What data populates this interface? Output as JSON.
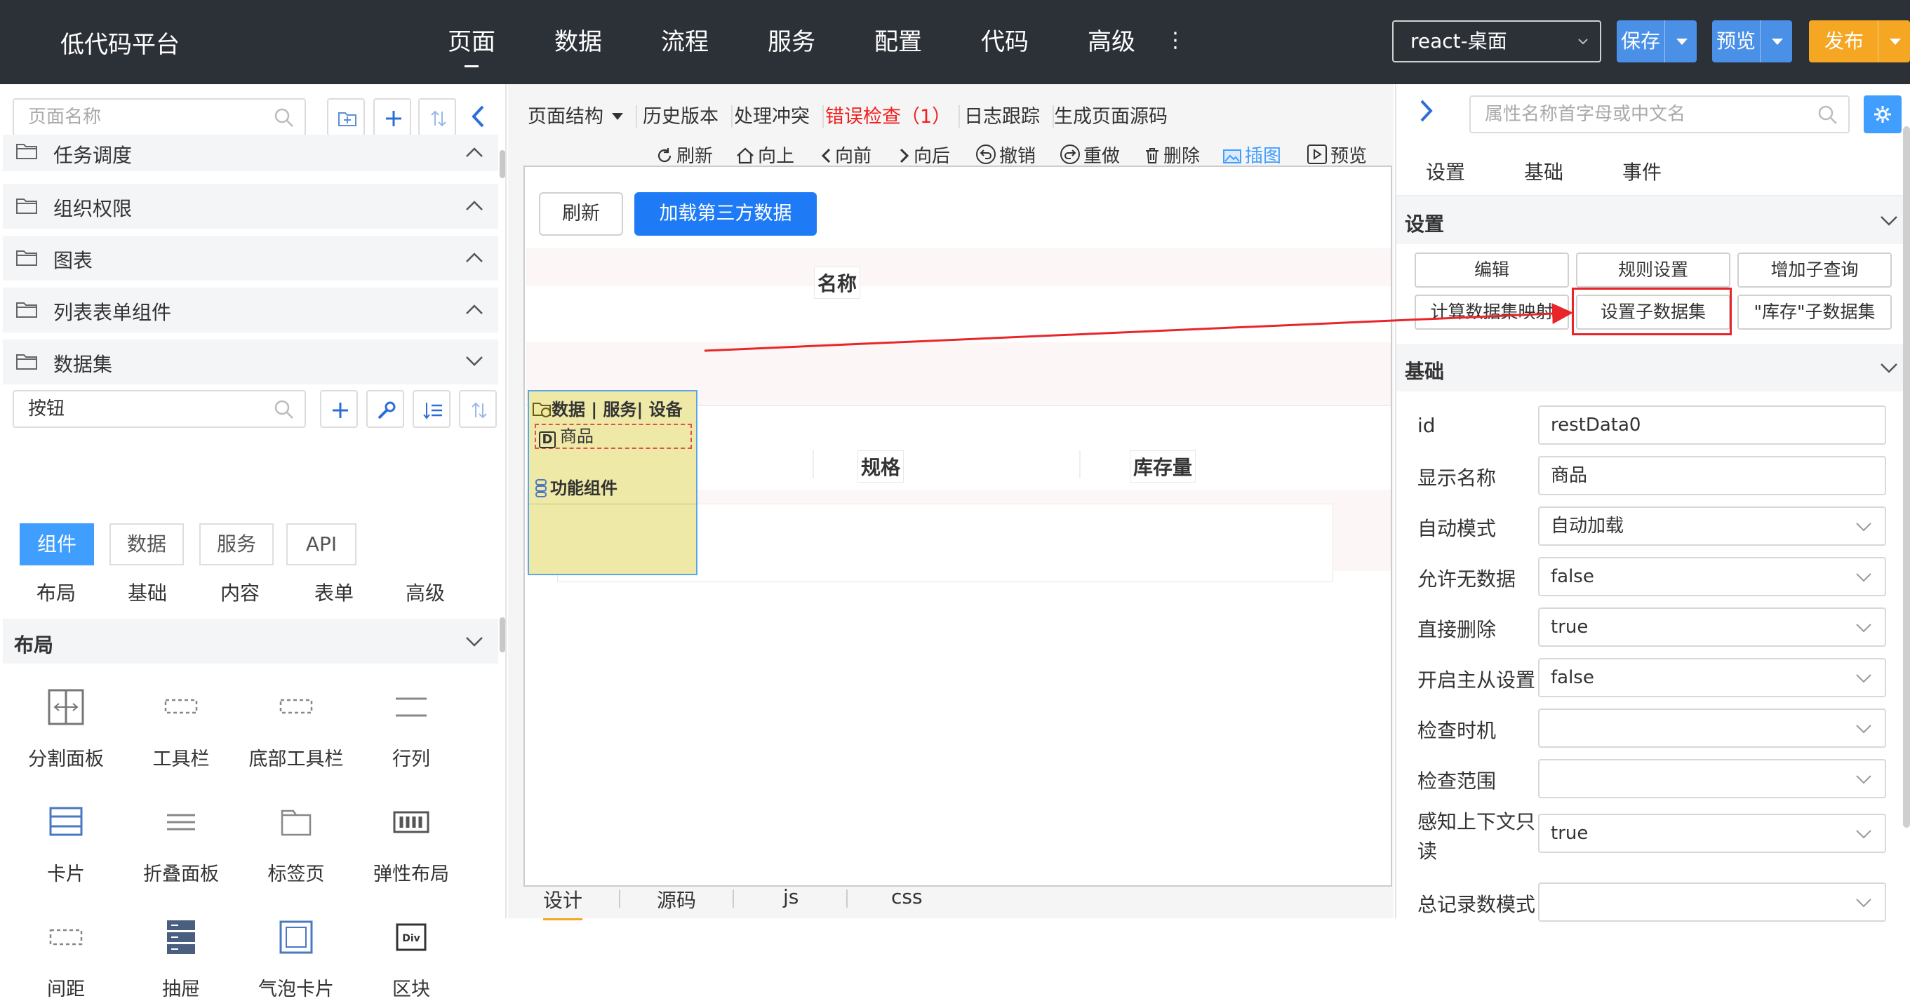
{
  "app": {
    "title": "低代码平台"
  },
  "topnav": {
    "items": [
      "页面",
      "数据",
      "流程",
      "服务",
      "配置",
      "代码",
      "高级"
    ],
    "more": "⋮"
  },
  "top_actions": {
    "env": "react-桌面",
    "save": "保存",
    "preview": "预览",
    "publish": "发布"
  },
  "left": {
    "page_search_placeholder": "页面名称",
    "tree": [
      "任务调度",
      "组织权限",
      "图表",
      "列表表单组件",
      "数据集"
    ],
    "comp_search_value": "按钮",
    "tabs": [
      "组件",
      "数据",
      "服务",
      "API"
    ],
    "subtabs": [
      "布局",
      "基础",
      "内容",
      "表单",
      "高级"
    ],
    "section_title": "布局",
    "components": [
      "分割面板",
      "工具栏",
      "底部工具栏",
      "行列",
      "卡片",
      "折叠面板",
      "标签页",
      "弹性布局",
      "间距",
      "抽屉",
      "气泡卡片",
      "区块"
    ],
    "block_icon_text": "Div"
  },
  "center": {
    "toolbar": [
      "页面结构",
      "历史版本",
      "处理冲突",
      "错误检查（1）",
      "日志跟踪",
      "生成页面源码"
    ],
    "actions": [
      "刷新",
      "向上",
      "向前",
      "向后",
      "撤销",
      "重做",
      "删除",
      "插图",
      "预览"
    ],
    "btn_refresh": "刷新",
    "btn_load": "加载第三方数据",
    "col_name": "名称",
    "col_spec": "规格",
    "col_stock": "库存量",
    "ds_header": "数据 | 服务| 设备",
    "ds_item_mark": "D",
    "ds_item": "商品",
    "ds_func": "功能组件",
    "bottom_tabs": [
      "设计",
      "源码",
      "js",
      "css"
    ]
  },
  "right": {
    "search_placeholder": "属性名称首字母或中文名",
    "tabs": [
      "设置",
      "基础",
      "事件"
    ],
    "settings_title": "设置",
    "settings_buttons": [
      "编辑",
      "规则设置",
      "增加子查询",
      "计算数据集映射",
      "设置子数据集",
      "\"库存\"子数据集"
    ],
    "basic_title": "基础",
    "props": [
      {
        "label": "id",
        "value": "restData0"
      },
      {
        "label": "显示名称",
        "value": "商品"
      },
      {
        "label": "自动模式",
        "value": "自动加载"
      },
      {
        "label": "允许无数据",
        "value": "false"
      },
      {
        "label": "直接删除",
        "value": "true"
      },
      {
        "label": "开启主从设置",
        "value": "false"
      },
      {
        "label": "检查时机",
        "value": ""
      },
      {
        "label": "检查范围",
        "value": ""
      },
      {
        "label": "感知上下文只",
        "label2": "读",
        "value": "true"
      },
      {
        "label": "总记录数模式",
        "value": ""
      }
    ]
  },
  "colors": {
    "topbar": "#2c3037",
    "primary": "#409eff",
    "blue_button": "#1f7bf5",
    "publish": "#f5a623",
    "error": "#f0201f",
    "highlight": "#e8262a"
  }
}
